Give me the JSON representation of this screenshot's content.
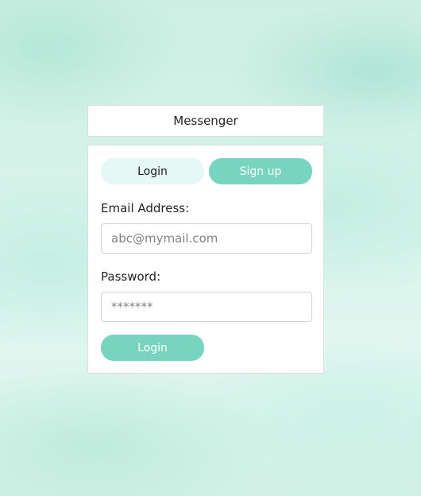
{
  "header": {
    "title": "Messenger"
  },
  "tabs": {
    "login_label": "Login",
    "signup_label": "Sign up",
    "active": "login"
  },
  "form": {
    "email_label": "Email Address:",
    "email_placeholder": "abc@mymail.com",
    "email_value": "",
    "password_label": "Password:",
    "password_placeholder": "*******",
    "password_value": "",
    "submit_label": "Login"
  },
  "colors": {
    "accent": "#78d4c0",
    "tab_inactive_bg": "#e6f8f4",
    "background": "#d7f3ea"
  }
}
